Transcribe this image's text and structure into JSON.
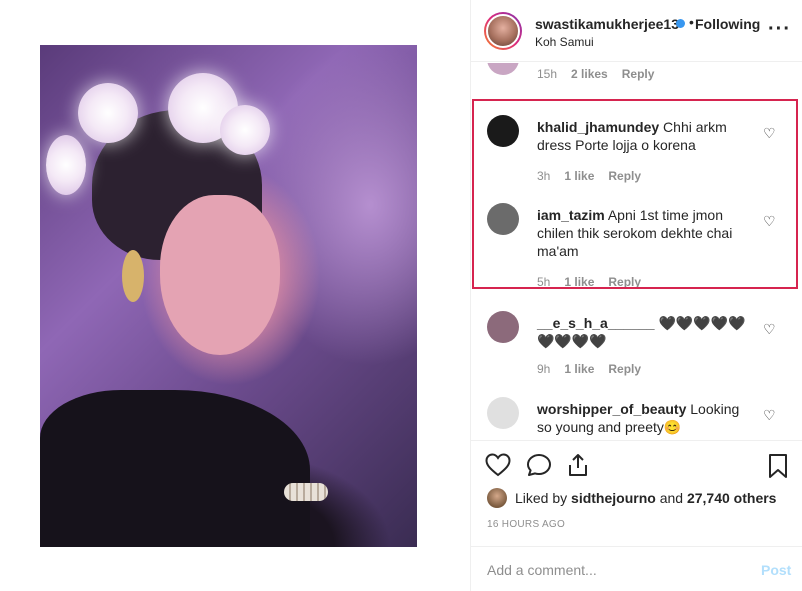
{
  "post": {
    "username": "swastikamukherjee13",
    "separator": "•",
    "follow_status": "Following",
    "location": "Koh Samui",
    "more_icon": "more-options-icon"
  },
  "comments": [
    {
      "username": "",
      "text": "",
      "time": "15h",
      "likes": "2 likes",
      "reply": "Reply",
      "avatar_color": "#c9a6c3"
    },
    {
      "username": "khalid_jhamundey",
      "text": "Chhi arkm dress Porte lojja o korena",
      "time": "3h",
      "likes": "1 like",
      "reply": "Reply",
      "avatar_color": "#1a1a1a"
    },
    {
      "username": "iam_tazim",
      "text": "Apni 1st time jmon chilen thik serokom dekhte chai ma'am",
      "time": "5h",
      "likes": "1 like",
      "reply": "Reply",
      "avatar_color": "#6b6b6b"
    },
    {
      "username": "__e_s_h_a______",
      "text": "🖤🖤🖤🖤🖤🖤🖤🖤🖤",
      "time": "9h",
      "likes": "1 like",
      "reply": "Reply",
      "avatar_color": "#8c6a7b"
    },
    {
      "username": "worshipper_of_beauty",
      "text": "Looking so young and preety😊",
      "time": "",
      "likes": "",
      "reply": "",
      "avatar_color": "#e0e0e0"
    }
  ],
  "actions": {
    "liked_by_prefix": "Liked by",
    "liked_by_user": "sidthejourno",
    "liked_by_and": "and",
    "liked_by_others": "27,740 others",
    "timestamp": "16 HOURS AGO"
  },
  "add_comment": {
    "placeholder": "Add a comment...",
    "post_label": "Post"
  },
  "colors": {
    "highlight_border": "#d6244f",
    "link_blue": "#3897f0",
    "post_disabled": "#b2dffc"
  }
}
